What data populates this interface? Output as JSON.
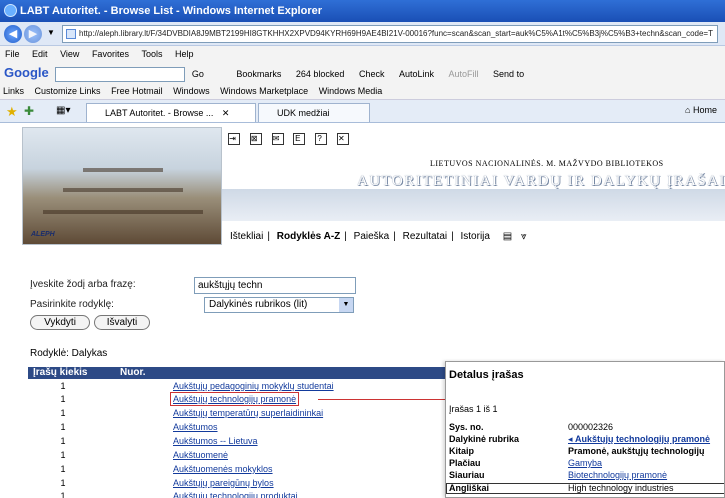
{
  "window": {
    "title": "LABT Autoritet. - Browse List - Windows Internet Explorer"
  },
  "address": {
    "url": "http://aleph.library.lt/F/34DVBDIA8J9MBT2199HI8GTKHHX2XPVD94KYRH69H9AE4BI21V-00016?func=scan&scan_start=auk%C5%A1t%C5%B3j%C5%B3+techn&scan_code=T"
  },
  "menu": [
    "File",
    "Edit",
    "View",
    "Favorites",
    "Tools",
    "Help"
  ],
  "google_bar": {
    "logo": "Google",
    "go": "Go",
    "bookmarks": "Bookmarks",
    "blocked": "264 blocked",
    "check": "Check",
    "autolink": "AutoLink",
    "autofill": "AutoFill",
    "send_to": "Send to"
  },
  "links_bar": {
    "label": "Links",
    "items": [
      "Customize Links",
      "Free Hotmail",
      "Windows",
      "Windows Marketplace",
      "Windows Media"
    ]
  },
  "tabs": [
    {
      "label": "LABT Autoritet. - Browse ..."
    },
    {
      "label": "UDK medžiai"
    }
  ],
  "home_label": "Home",
  "banner": {
    "logo": "ALEPH",
    "library_name": "LIETUVOS NACIONALINĖS. M. MAŽVYDO BIBLIOTEKOS",
    "heading": "AUTORITETINIAI VARDŲ IR DALYKŲ ĮRAŠAI"
  },
  "nav": {
    "items": [
      "Ištekliai",
      "Rodyklės A-Z",
      "Paieška",
      "Rezultatai",
      "Istorija"
    ]
  },
  "form": {
    "input_label": "Įveskite žodį arba frazę:",
    "input_value": "aukštųjų techn",
    "select_label": "Pasirinkite rodyklę:",
    "select_value": "Dalykinės rubrikos (lit)",
    "run_button": "Vykdyti",
    "clear_button": "Išvalyti"
  },
  "results": {
    "index_label": "Rodyklė: Dalykas",
    "columns": [
      "Įrašų kiekis",
      "Nuor."
    ],
    "rows": [
      {
        "count": "1",
        "term": "Aukštųjų pedagoginių mokyklų studentai"
      },
      {
        "count": "1",
        "term": "Aukštųjų technologijų pramonė"
      },
      {
        "count": "1",
        "term": "Aukštųjų temperatūrų superlaidininkai"
      },
      {
        "count": "1",
        "term": "Aukštumos"
      },
      {
        "count": "1",
        "term": "Aukštumos -- Lietuva"
      },
      {
        "count": "1",
        "term": "Aukštuomenė"
      },
      {
        "count": "1",
        "term": "Aukštuomenės mokyklos"
      },
      {
        "count": "1",
        "term": "Aukštųjų pareigūnų bylos"
      },
      {
        "count": "1",
        "term": "Aukštųjų technologijų produktai"
      }
    ]
  },
  "detail": {
    "title": "Detalus įrašas",
    "count": "Įrašas 1 iš 1",
    "rows": [
      {
        "k": "Sys. no.",
        "v": "000002326"
      },
      {
        "k": "Dalykinė rubrika",
        "v": "Aukštųjų technologijų pramonė"
      },
      {
        "k": "Kitaip",
        "v": "Pramonė, aukštųjų technologijų"
      },
      {
        "k": "Plačiau",
        "v": "Gamyba"
      },
      {
        "k": "Siauriau",
        "v": "Biotechnologijų pramonė"
      },
      {
        "k": "Angliškai",
        "v": "High technology industries"
      }
    ]
  }
}
